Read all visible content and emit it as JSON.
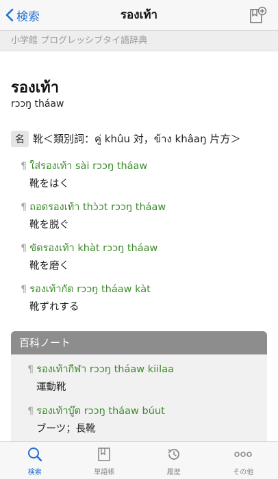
{
  "nav": {
    "back_label": "検索",
    "title": "รองเท้า"
  },
  "dictionary_name": "小学館 プログレッシブタイ語辞典",
  "entry": {
    "headword": "รองเท้า",
    "pronunciation": "rɔɔŋ tháaw",
    "pos_badge": "名",
    "definition": "靴＜類別詞：คู่ khûu 対，ข้าง khâaŋ 片方＞",
    "examples": [
      {
        "thai": "ใส่รองเท้า sài rɔɔŋ tháaw",
        "meaning": "靴をはく"
      },
      {
        "thai": "ถอดรองเท้า thɔ̀ɔt rɔɔŋ tháaw",
        "meaning": "靴を脱ぐ"
      },
      {
        "thai": "ขัดรองเท้า khàt rɔɔŋ tháaw",
        "meaning": "靴を磨く"
      },
      {
        "thai": "รองเท้ากัด rɔɔŋ tháaw kàt",
        "meaning": "靴ずれする"
      }
    ],
    "pilcrow": "¶"
  },
  "note": {
    "title": "百科ノート",
    "items": [
      {
        "thai": "รองเท้ากีฬา rɔɔŋ tháaw kiilaa",
        "meaning": "運動靴"
      },
      {
        "thai": "รองเท้าบู๊ต rɔɔŋ tháaw búut",
        "meaning": "ブーツ；長靴"
      }
    ]
  },
  "tabs": [
    {
      "label": "検索",
      "icon": "search-icon",
      "active": true
    },
    {
      "label": "単語帳",
      "icon": "book-icon",
      "active": false
    },
    {
      "label": "履歴",
      "icon": "history-icon",
      "active": false
    },
    {
      "label": "その他",
      "icon": "more-icon",
      "active": false
    }
  ],
  "colors": {
    "accent": "#1f6fd1",
    "example_green": "#3b8a2a",
    "note_header": "#8d8d8d"
  }
}
